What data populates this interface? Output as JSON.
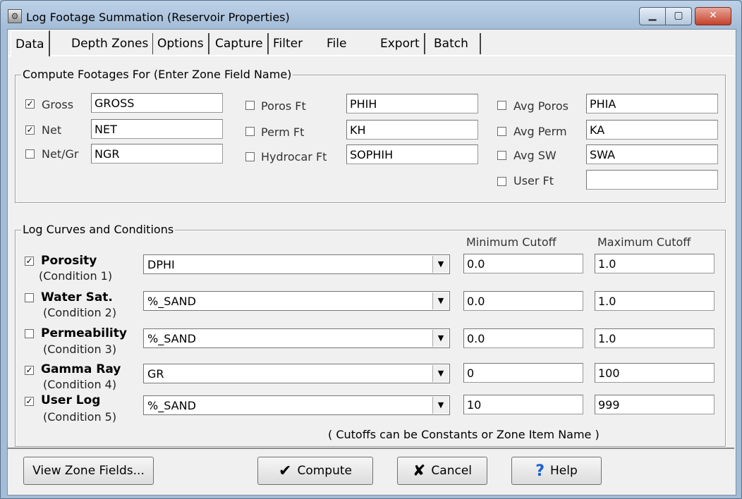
{
  "window": {
    "title": "Log Footage Summation (Reservoir Properties)"
  },
  "tabs": [
    "Data",
    "Depth Zones",
    "Options",
    "Capture",
    "Filter",
    "File",
    "Export",
    "Batch"
  ],
  "compute_group": {
    "legend": "Compute Footages For  (Enter Zone Field Name)",
    "fields": [
      {
        "label": "Gross",
        "checked": true,
        "value": "GROSS"
      },
      {
        "label": "Net",
        "checked": true,
        "value": "NET"
      },
      {
        "label": "Net/Gr",
        "checked": false,
        "value": "NGR"
      },
      {
        "label": "Poros Ft",
        "checked": false,
        "value": "PHIH"
      },
      {
        "label": "Perm Ft",
        "checked": false,
        "value": "KH"
      },
      {
        "label": "Hydrocar Ft",
        "checked": false,
        "value": "SOPHIH"
      },
      {
        "label": "Avg Poros",
        "checked": false,
        "value": "PHIA"
      },
      {
        "label": "Avg Perm",
        "checked": false,
        "value": "KA"
      },
      {
        "label": "Avg SW",
        "checked": false,
        "value": "SWA"
      },
      {
        "label": "User Ft",
        "checked": false,
        "value": ""
      }
    ]
  },
  "curves_group": {
    "legend": "Log Curves and Conditions",
    "min_header": "Minimum Cutoff",
    "max_header": "Maximum Cutoff",
    "rows": [
      {
        "name": "Porosity",
        "condition": "(Condition 1)",
        "checked": true,
        "curve": "DPHI",
        "min": "0.0",
        "max": "1.0"
      },
      {
        "name": "Water Sat.",
        "condition": "(Condition 2)",
        "checked": false,
        "curve": "%_SAND",
        "min": "0.0",
        "max": "1.0"
      },
      {
        "name": "Permeability",
        "condition": "(Condition 3)",
        "checked": false,
        "curve": "%_SAND",
        "min": "0.0",
        "max": "1.0"
      },
      {
        "name": "Gamma Ray",
        "condition": "(Condition 4)",
        "checked": true,
        "curve": "GR",
        "min": "0",
        "max": "100"
      },
      {
        "name": "User Log",
        "condition": "(Condition 5)",
        "checked": true,
        "curve": "%_SAND",
        "min": "10",
        "max": "999"
      }
    ],
    "note": "( Cutoffs can be Constants or Zone Item Name )"
  },
  "buttons": {
    "view_zone_fields": "View Zone Fields...",
    "compute": "Compute",
    "cancel": "Cancel",
    "help": "Help"
  },
  "glyphs": {
    "check": "✔",
    "cross": "✘",
    "question": "?",
    "dropdown": "▼",
    "checkmark_box": "✓"
  }
}
